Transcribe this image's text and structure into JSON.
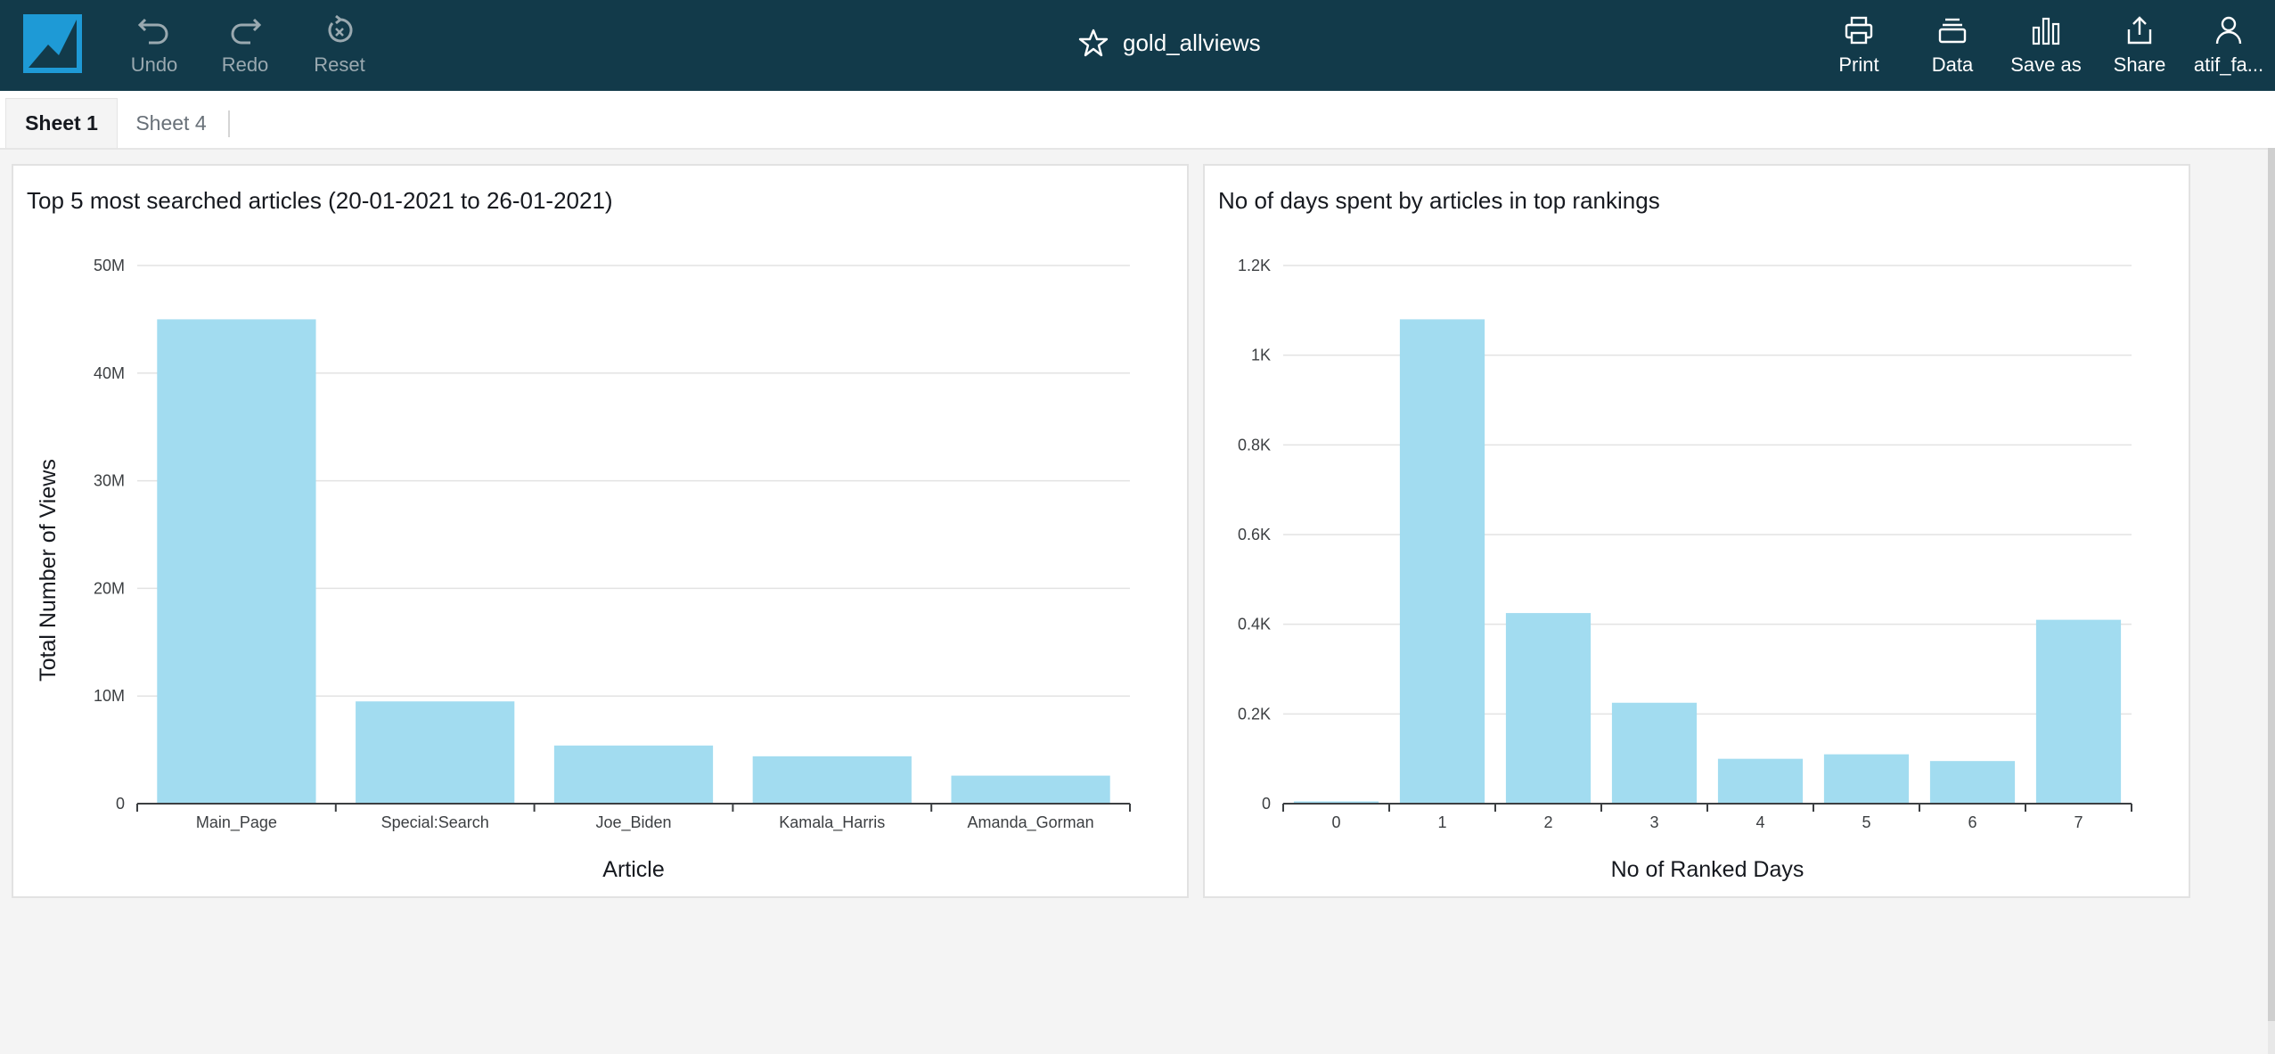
{
  "app": {
    "title": "gold_allviews",
    "toolbar_left": [
      {
        "key": "undo",
        "label": "Undo",
        "icon": "undo-icon"
      },
      {
        "key": "redo",
        "label": "Redo",
        "icon": "redo-icon"
      },
      {
        "key": "reset",
        "label": "Reset",
        "icon": "reset-icon"
      }
    ],
    "toolbar_right": [
      {
        "key": "print",
        "label": "Print",
        "icon": "printer-icon"
      },
      {
        "key": "data",
        "label": "Data",
        "icon": "data-stack-icon"
      },
      {
        "key": "save_as",
        "label": "Save as",
        "icon": "bar-chart-icon"
      },
      {
        "key": "share",
        "label": "Share",
        "icon": "share-icon"
      },
      {
        "key": "user",
        "label": "atif_fa...",
        "icon": "user-icon"
      }
    ],
    "colors": {
      "topbar": "#123a4a",
      "bar": "#a2dcf0",
      "accent": "#1e9ad6"
    }
  },
  "tabs": [
    {
      "label": "Sheet 1",
      "active": true
    },
    {
      "label": "Sheet 4",
      "active": false
    }
  ],
  "chart_data": [
    {
      "type": "bar",
      "title": "Top 5 most searched articles (20-01-2021 to 26-01-2021)",
      "xlabel": "Article",
      "ylabel": "Total Number of Views",
      "categories": [
        "Main_Page",
        "Special:Search",
        "Joe_Biden",
        "Kamala_Harris",
        "Amanda_Gorman"
      ],
      "values": [
        45000000,
        9500000,
        5400000,
        4400000,
        2600000
      ],
      "ylim": [
        0,
        50000000
      ],
      "yticks": [
        0,
        10000000,
        20000000,
        30000000,
        40000000,
        50000000
      ],
      "ytick_labels": [
        "0",
        "10M",
        "20M",
        "30M",
        "40M",
        "50M"
      ],
      "grid": true
    },
    {
      "type": "bar",
      "title": "No of days spent by articles in top rankings",
      "xlabel": "No of Ranked Days",
      "ylabel": "",
      "categories": [
        "0",
        "1",
        "2",
        "3",
        "4",
        "5",
        "6",
        "7"
      ],
      "values": [
        5,
        1080,
        425,
        225,
        100,
        110,
        95,
        410
      ],
      "ylim": [
        0,
        1200
      ],
      "yticks": [
        0,
        200,
        400,
        600,
        800,
        1000,
        1200
      ],
      "ytick_labels": [
        "0",
        "0.2K",
        "0.4K",
        "0.6K",
        "0.8K",
        "1K",
        "1.2K"
      ],
      "grid": true
    }
  ]
}
